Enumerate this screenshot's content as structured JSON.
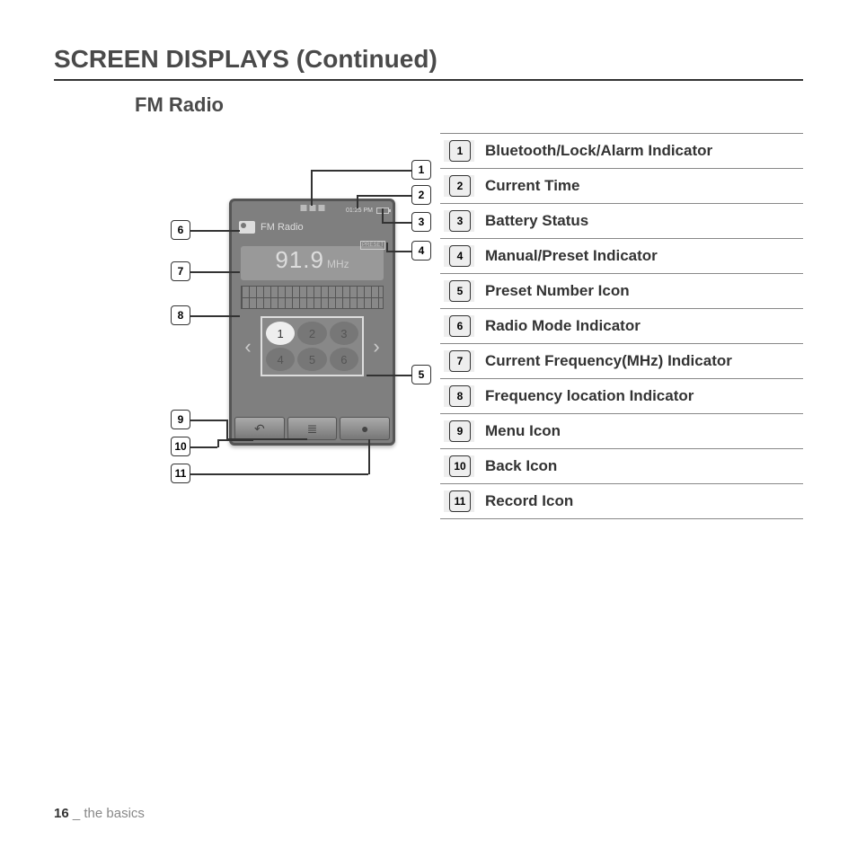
{
  "page": {
    "title": "SCREEN DISPLAYS (Continued)",
    "section": "FM Radio",
    "footer_page": "16",
    "footer_sep": " _ ",
    "footer_text": "the basics"
  },
  "device": {
    "time": "01:25 PM",
    "mode_label": "FM Radio",
    "preset_badge": "PRESET",
    "frequency": "91.9",
    "frequency_unit": "MHz",
    "presets": [
      "1",
      "2",
      "3",
      "4",
      "5",
      "6"
    ],
    "nav_prev": "‹",
    "nav_next": "›",
    "back_glyph": "↶",
    "menu_glyph": "≣",
    "record_glyph": "●"
  },
  "callouts": {
    "c1": "1",
    "c2": "2",
    "c3": "3",
    "c4": "4",
    "c5": "5",
    "c6": "6",
    "c7": "7",
    "c8": "8",
    "c9": "9",
    "c10": "10",
    "c11": "11"
  },
  "legend": [
    {
      "n": "1",
      "label": "Bluetooth/Lock/Alarm Indicator"
    },
    {
      "n": "2",
      "label": "Current Time"
    },
    {
      "n": "3",
      "label": "Battery Status"
    },
    {
      "n": "4",
      "label": "Manual/Preset Indicator"
    },
    {
      "n": "5",
      "label": "Preset Number Icon"
    },
    {
      "n": "6",
      "label": "Radio Mode Indicator"
    },
    {
      "n": "7",
      "label": "Current Frequency(MHz) Indicator"
    },
    {
      "n": "8",
      "label": "Frequency location Indicator"
    },
    {
      "n": "9",
      "label": "Menu Icon"
    },
    {
      "n": "10",
      "label": "Back Icon"
    },
    {
      "n": "11",
      "label": "Record Icon"
    }
  ]
}
